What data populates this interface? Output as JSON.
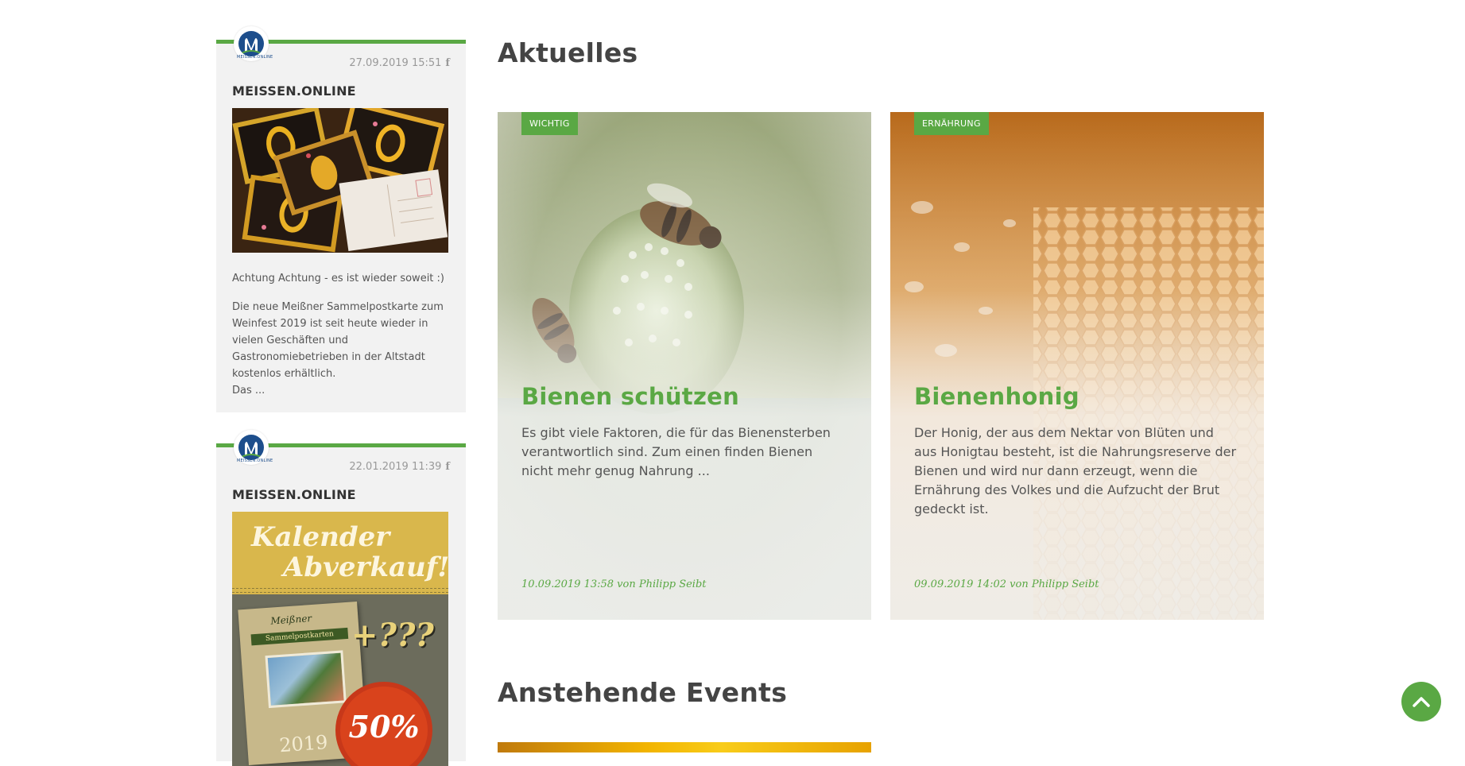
{
  "sidebar": {
    "posts": [
      {
        "logo_text": "MEISSEN.ONLINE",
        "timestamp": "27.09.2019 15:51",
        "author": "MEISSEN.ONLINE",
        "paragraphs": [
          "Achtung Achtung - es ist wieder soweit :)",
          "Die neue Meißner Sammelpostkarte zum Weinfest 2019 ist seit heute wieder in vielen Geschäften und Gastronomiebetrieben in der Altstadt kostenlos erhältlich.\nDas ..."
        ]
      },
      {
        "logo_text": "MEISSEN.ONLINE",
        "timestamp": "22.01.2019 11:39",
        "author": "MEISSEN.ONLINE",
        "promo": {
          "line1": "Kalender",
          "line2": "Abverkauf!",
          "book_title": "Meißner",
          "book_subtitle": "Sammelpostkarten",
          "plus": "+???",
          "year": "2019",
          "discount": "50%"
        }
      }
    ]
  },
  "main": {
    "news_heading": "Aktuelles",
    "articles": [
      {
        "badge": "WICHTIG",
        "title": "Bienen schützen",
        "teaser": "Es gibt viele Faktoren, die für das Bienensterben verantwortlich sind. Zum einen finden Bienen nicht mehr genug Nahrung ...",
        "meta": "10.09.2019 13:58 von Philipp Seibt"
      },
      {
        "badge": "ERNÄHRUNG",
        "title": "Bienenhonig",
        "teaser": "Der Honig, der aus dem Nektar von Blüten und aus Honigtau besteht, ist die Nahrungsreserve der Bienen und wird nur dann erzeugt, wenn die Ernährung des Volkes und die Aufzucht der Brut gedeckt ist.",
        "meta": "09.09.2019 14:02 von Philipp Seibt"
      }
    ],
    "events_heading": "Anstehende Events"
  },
  "colors": {
    "accent": "#5aa844",
    "heading": "#444444",
    "logo_blue": "#1d4e8c"
  },
  "icons": {
    "facebook": "f",
    "back_to_top": "chevron-up-icon"
  }
}
